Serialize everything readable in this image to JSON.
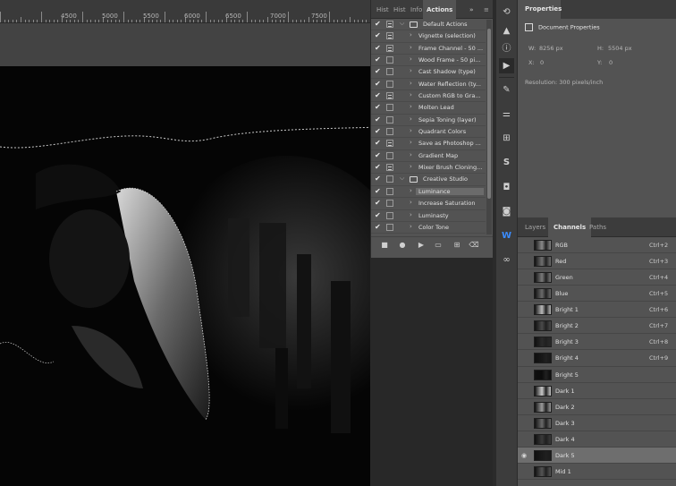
{
  "ruler": {
    "labels": [
      "4500",
      "5000",
      "5500",
      "6000",
      "6500",
      "7000",
      "7500"
    ]
  },
  "actions_panel": {
    "tabs": [
      "Hist",
      "Hist",
      "Info",
      "Actions"
    ],
    "active_tab": "Actions",
    "items": [
      {
        "label": "Default Actions",
        "type": "folder",
        "dialog": true
      },
      {
        "label": "Vignette (selection)",
        "type": "action",
        "dialog": true
      },
      {
        "label": "Frame Channel - 50 ...",
        "type": "action",
        "dialog": true
      },
      {
        "label": "Wood Frame - 50 pi...",
        "type": "action",
        "dialog": false
      },
      {
        "label": "Cast Shadow (type)",
        "type": "action",
        "dialog": false
      },
      {
        "label": "Water Reflection (ty...",
        "type": "action",
        "dialog": false
      },
      {
        "label": "Custom RGB to Gra...",
        "type": "action",
        "dialog": true
      },
      {
        "label": "Molten Lead",
        "type": "action",
        "dialog": false
      },
      {
        "label": "Sepia Toning (layer)",
        "type": "action",
        "dialog": false
      },
      {
        "label": "Quadrant Colors",
        "type": "action",
        "dialog": false
      },
      {
        "label": "Save as Photoshop ...",
        "type": "action",
        "dialog": true
      },
      {
        "label": "Gradient Map",
        "type": "action",
        "dialog": false
      },
      {
        "label": "Mixer Brush Cloning...",
        "type": "action",
        "dialog": true
      },
      {
        "label": "Creative Studio",
        "type": "folder",
        "dialog": false
      },
      {
        "label": "Luminance",
        "type": "action",
        "dialog": false,
        "selected": true
      },
      {
        "label": "Increase Saturation",
        "type": "action",
        "dialog": false
      },
      {
        "label": "Luminasty",
        "type": "action",
        "dialog": false
      },
      {
        "label": "Color Tone",
        "type": "action",
        "dialog": false
      }
    ],
    "footer_icons": [
      "stop-icon",
      "record-icon",
      "play-icon",
      "new-set-icon",
      "new-action-icon",
      "delete-icon"
    ]
  },
  "icon_strip": [
    "history-icon",
    "histogram-icon",
    "info-icon",
    "actions-play-icon",
    "brush-icon",
    "adjust-icon",
    "grid-icon",
    "s-icon",
    "camera-icon",
    "instagram-icon",
    "w-icon",
    "loop-icon"
  ],
  "properties": {
    "tab": "Properties",
    "type_label": "Document Properties",
    "w_label": "W:",
    "w_value": "8256 px",
    "h_label": "H:",
    "h_value": "5504 px",
    "x_label": "X:",
    "x_value": "0",
    "y_label": "Y:",
    "y_value": "0",
    "resolution": "Resolution: 300 pixels/inch"
  },
  "channels_panel": {
    "tabs": [
      "Layers",
      "Channels",
      "Paths"
    ],
    "active_tab": "Channels",
    "rows": [
      {
        "name": "RGB",
        "key": "Ctrl+2",
        "visible": false
      },
      {
        "name": "Red",
        "key": "Ctrl+3",
        "visible": false
      },
      {
        "name": "Green",
        "key": "Ctrl+4",
        "visible": false
      },
      {
        "name": "Blue",
        "key": "Ctrl+5",
        "visible": false
      },
      {
        "name": "Bright 1",
        "key": "Ctrl+6",
        "visible": false
      },
      {
        "name": "Bright 2",
        "key": "Ctrl+7",
        "visible": false
      },
      {
        "name": "Bright 3",
        "key": "Ctrl+8",
        "visible": false
      },
      {
        "name": "Bright 4",
        "key": "Ctrl+9",
        "visible": false
      },
      {
        "name": "Bright 5",
        "key": "",
        "visible": false
      },
      {
        "name": "Dark 1",
        "key": "",
        "visible": false
      },
      {
        "name": "Dark 2",
        "key": "",
        "visible": false
      },
      {
        "name": "Dark 3",
        "key": "",
        "visible": false
      },
      {
        "name": "Dark 4",
        "key": "",
        "visible": false
      },
      {
        "name": "Dark 5",
        "key": "",
        "visible": true,
        "selected": true
      },
      {
        "name": "Mid 1",
        "key": "",
        "visible": false
      }
    ]
  }
}
